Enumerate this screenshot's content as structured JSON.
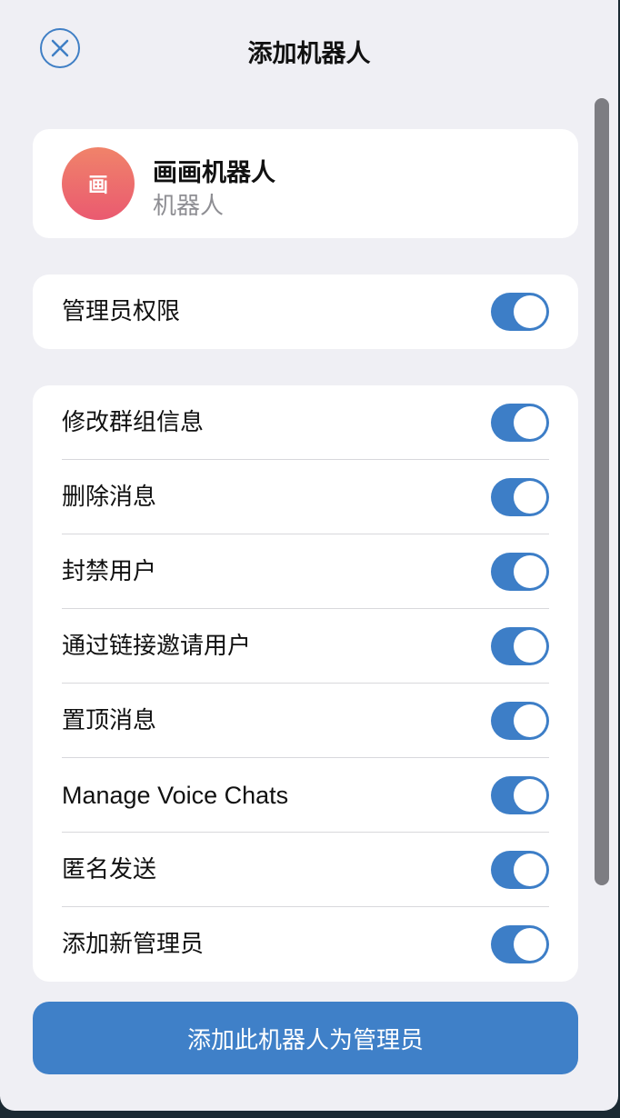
{
  "header": {
    "title": "添加机器人",
    "close_icon": "close-icon"
  },
  "bot": {
    "avatar_glyph": "画",
    "name": "画画机器人",
    "type": "机器人",
    "avatar_gradient": [
      "#f0836a",
      "#ea5a70"
    ]
  },
  "admin": {
    "label": "管理员权限",
    "enabled": true
  },
  "permissions": [
    {
      "label": "修改群组信息",
      "enabled": true
    },
    {
      "label": "删除消息",
      "enabled": true
    },
    {
      "label": "封禁用户",
      "enabled": true
    },
    {
      "label": "通过链接邀请用户",
      "enabled": true
    },
    {
      "label": "置顶消息",
      "enabled": true
    },
    {
      "label": "Manage Voice Chats",
      "enabled": true
    },
    {
      "label": "匿名发送",
      "enabled": true
    },
    {
      "label": "添加新管理员",
      "enabled": true
    }
  ],
  "submit_label": "添加此机器人为管理员",
  "colors": {
    "accent": "#3f80c8",
    "background": "#efeff4",
    "card": "#ffffff"
  }
}
